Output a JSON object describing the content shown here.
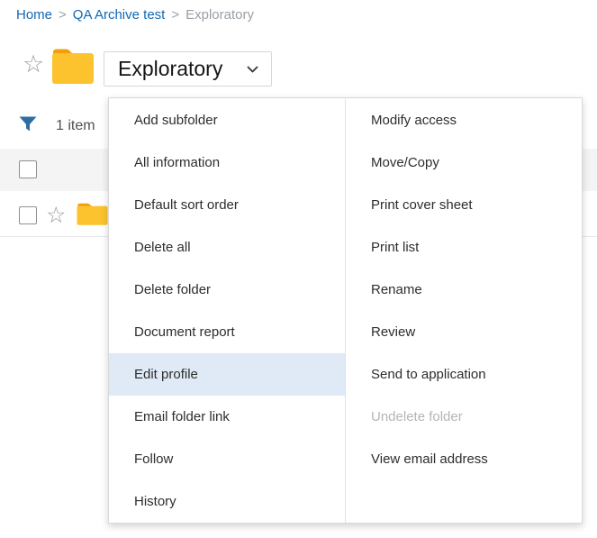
{
  "breadcrumb": {
    "separator": ">",
    "items": [
      {
        "label": "Home"
      },
      {
        "label": "QA Archive test"
      },
      {
        "label": "Exploratory"
      }
    ]
  },
  "folder_header": {
    "title": "Exploratory"
  },
  "toolbar": {
    "item_count": "1 item"
  },
  "icons": {
    "star_outline": "☆"
  },
  "menu": {
    "left_items": [
      {
        "label": "Add subfolder"
      },
      {
        "label": "All information"
      },
      {
        "label": "Default sort order"
      },
      {
        "label": "Delete all"
      },
      {
        "label": "Delete folder"
      },
      {
        "label": "Document report"
      },
      {
        "label": "Edit profile",
        "highlighted": true
      },
      {
        "label": "Email folder link"
      },
      {
        "label": "Follow"
      },
      {
        "label": "History"
      }
    ],
    "right_items": [
      {
        "label": "Modify access"
      },
      {
        "label": "Move/Copy"
      },
      {
        "label": "Print cover sheet"
      },
      {
        "label": "Print list"
      },
      {
        "label": "Rename"
      },
      {
        "label": "Review"
      },
      {
        "label": "Send to application"
      },
      {
        "label": "Undelete folder",
        "disabled": true
      },
      {
        "label": "View email address"
      }
    ]
  },
  "colors": {
    "link_blue": "#1268b3",
    "menu_highlight": "#dfeaf6",
    "folder_yellow": "#fcc32e",
    "folder_tab_orange": "#f29d0e",
    "filter_blue": "#2e6da3",
    "disabled_text": "#b5b5b5",
    "header_row_gray": "#f4f4f4"
  }
}
